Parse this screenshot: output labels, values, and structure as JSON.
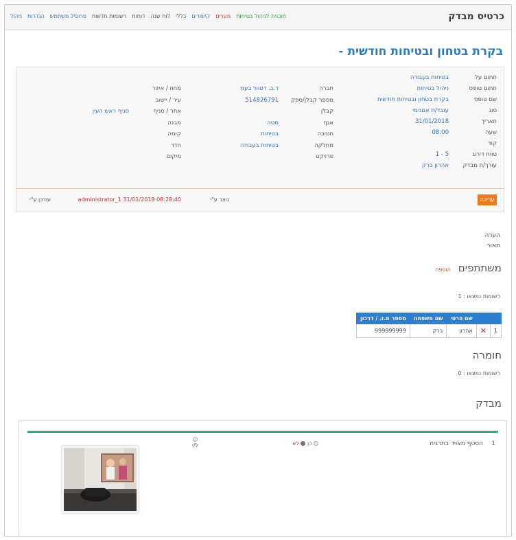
{
  "topbar": {
    "title": "כרטיס מבדק",
    "links": [
      {
        "label": "תוכנית לניהול בטיחות",
        "color": "#2e9a4e"
      },
      {
        "label": "מערים",
        "color": "#d23b3b"
      },
      {
        "label": "קישורים",
        "color": "#3a6fc3"
      },
      {
        "label": "כללי",
        "color": "#555555"
      },
      {
        "label": "לוח שנה",
        "color": "#555555"
      },
      {
        "label": "דוחות",
        "color": "#555555"
      },
      {
        "label": "רשומות חדשות",
        "color": "#555555"
      },
      {
        "label": "פרופיל משתמש",
        "color": "#3a6fc3"
      },
      {
        "label": "הגדרות",
        "color": "#3a6fc3"
      },
      {
        "label": "ניהול",
        "color": "#3a6fc3"
      }
    ]
  },
  "page_title": "בקרת בטחון ובטיחות חודשית -",
  "details": {
    "col1": [
      {
        "label": "תחום על",
        "value": "בטיחות בעבודה"
      },
      {
        "label": "תחום טופס",
        "value": "ניהול בטיחות"
      },
      {
        "label": "שם טופס",
        "value": "בקרת בטחון ובטיחות חודשית"
      },
      {
        "label": "סוג",
        "value": "עובד/ת אנונימי"
      },
      {
        "label": "תאריך",
        "value": "31/01/2018"
      },
      {
        "label": "שעה",
        "value": "08:00"
      },
      {
        "label": "קוד",
        "value": ""
      },
      {
        "label": "טווח דירוג",
        "value": "5 - 1"
      },
      {
        "label": "עורך/ת מבדק",
        "value": "אהרון ברק"
      }
    ],
    "col2": [
      {
        "label": "חברה",
        "value": "ד.ב. דטווד בעמ"
      },
      {
        "label": "מספר קבלן/ספק",
        "value": "514826791"
      },
      {
        "label": "קבלן",
        "value": ""
      },
      {
        "label": "אגף",
        "value": "מטה"
      },
      {
        "label": "חטיבה",
        "value": "בטיחות"
      },
      {
        "label": "מחלקה",
        "value": "בטיחות בעבודה"
      },
      {
        "label": "פרויקט",
        "value": ""
      }
    ],
    "col3": [
      {
        "label": "מחוז / איזור",
        "value": ""
      },
      {
        "label": "עיר / יישוב",
        "value": ""
      },
      {
        "label": "אתר / סניף",
        "value": "סניף ראש העין"
      },
      {
        "label": "מבנה",
        "value": ""
      },
      {
        "label": "קומה",
        "value": ""
      },
      {
        "label": "חדר",
        "value": ""
      },
      {
        "label": "מיקום",
        "value": ""
      }
    ],
    "edit_label": "עריכה",
    "created_label": "נוצר ע\"י",
    "created_value": "administrator_1 31/01/2018 08:28:40",
    "updated_label": "עודכן ע\"י"
  },
  "notes": {
    "comment_label": "הערה",
    "description_label": "תאור"
  },
  "participants": {
    "heading": "משתתפים",
    "add_label": "הוספה",
    "count_text": "רשומות נמצאו : 1",
    "columns": [
      "שם פרטי",
      "שם משפחה",
      "מספר ת.ז. / דרכון"
    ],
    "rows": [
      {
        "num": "1",
        "first": "אהרון",
        "last": "ברק",
        "id": "999999999"
      }
    ]
  },
  "material": {
    "heading": "חומרה",
    "count_text": "רשומות נמצאו : 0"
  },
  "inspection": {
    "heading": "מבדק",
    "item_num": "1",
    "item_text": "הסטף מצויד בתרגית",
    "yes_label": "כן",
    "no_label": "לא",
    "na_label": "ל/י",
    "selected": "no"
  },
  "colors": {
    "accent_blue": "#2a7ab8",
    "header_blue": "#2f7fcf",
    "orange": "#f07a17",
    "green": "#2fa884",
    "red": "#d42222"
  }
}
